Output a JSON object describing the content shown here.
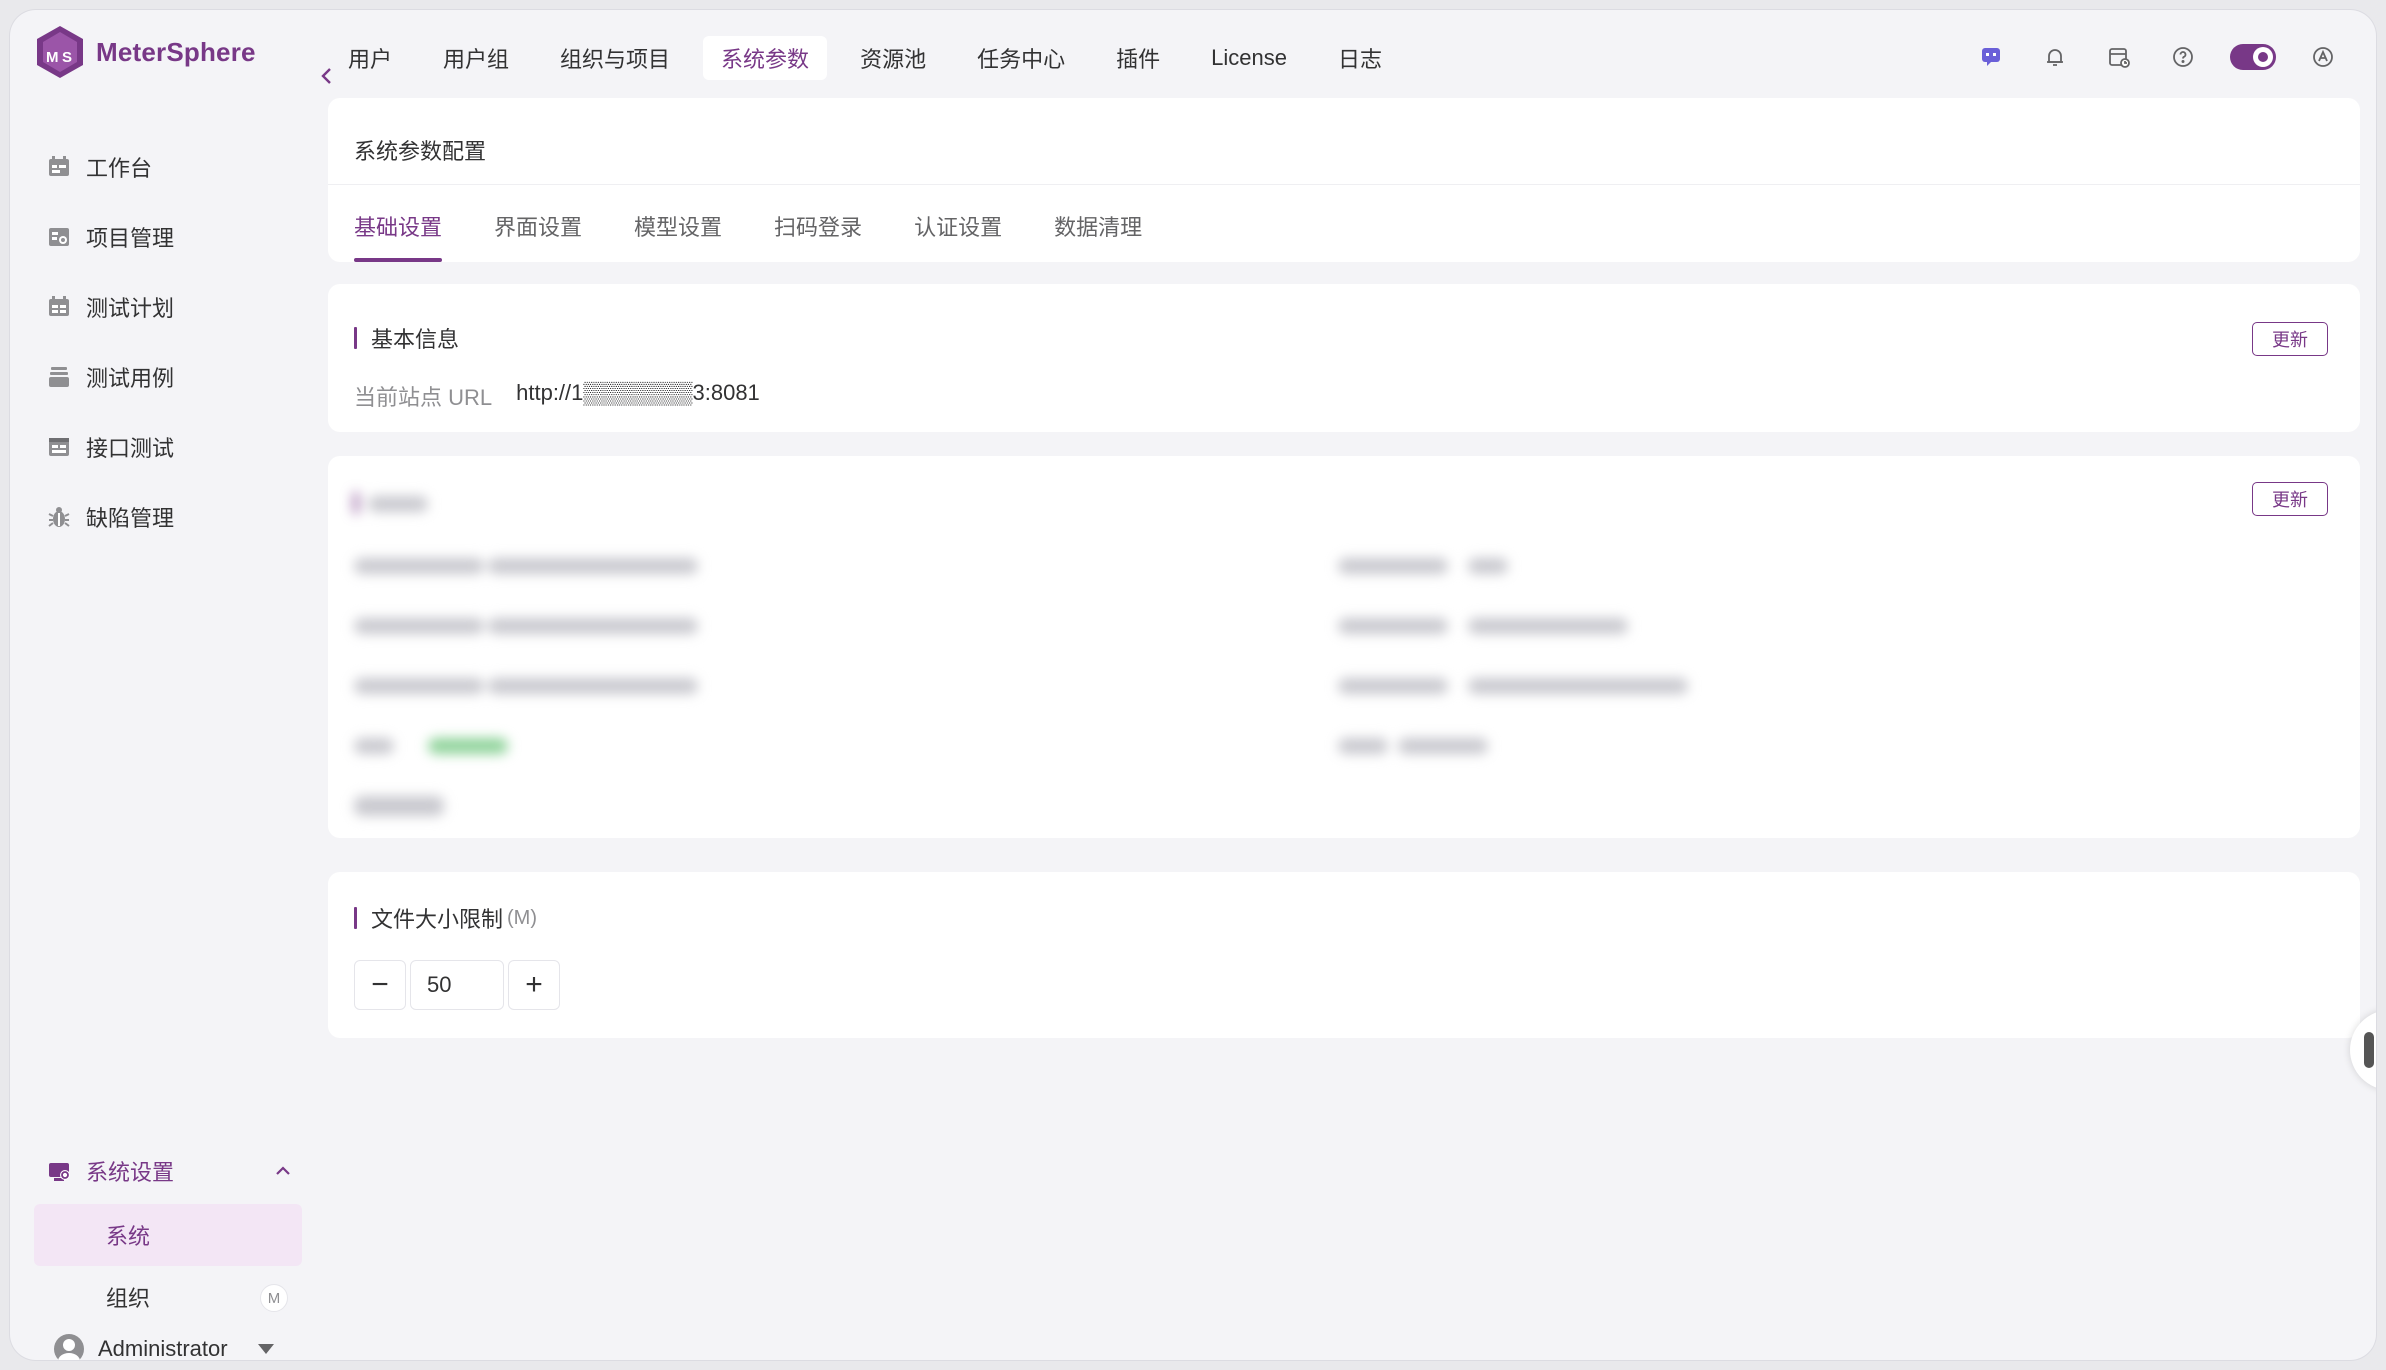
{
  "app": {
    "name": "MeterSphere"
  },
  "nav": {
    "items": [
      {
        "label": "用户"
      },
      {
        "label": "用户组"
      },
      {
        "label": "组织与项目"
      },
      {
        "label": "系统参数"
      },
      {
        "label": "资源池"
      },
      {
        "label": "任务中心"
      },
      {
        "label": "插件"
      },
      {
        "label": "License"
      },
      {
        "label": "日志"
      }
    ],
    "active_index": 3
  },
  "header_icons": [
    "chat-icon",
    "bell-icon",
    "task-icon",
    "help-icon",
    "theme-toggle",
    "language-icon"
  ],
  "sidebar": {
    "items": [
      {
        "label": "工作台",
        "icon": "workbench-icon"
      },
      {
        "label": "项目管理",
        "icon": "project-icon"
      },
      {
        "label": "测试计划",
        "icon": "test-plan-icon"
      },
      {
        "label": "测试用例",
        "icon": "test-case-icon"
      },
      {
        "label": "接口测试",
        "icon": "api-test-icon"
      },
      {
        "label": "缺陷管理",
        "icon": "bug-icon"
      }
    ],
    "settings": {
      "label": "系统设置",
      "children": [
        {
          "label": "系统",
          "active": true
        },
        {
          "label": "组织",
          "badge": "M"
        }
      ]
    },
    "user": {
      "name": "Administrator"
    }
  },
  "page": {
    "title": "系统参数配置",
    "tabs": [
      {
        "label": "基础设置"
      },
      {
        "label": "界面设置"
      },
      {
        "label": "模型设置"
      },
      {
        "label": "扫码登录"
      },
      {
        "label": "认证设置"
      },
      {
        "label": "数据清理"
      }
    ],
    "active_tab": 0
  },
  "basic_info": {
    "title": "基本信息",
    "update_label": "更新",
    "site_url_label": "当前站点 URL",
    "site_url_value": "http://1▒▒▒▒▒▒▒3:8081"
  },
  "mail": {
    "update_label": "更新"
  },
  "file_limit": {
    "title": "文件大小限制",
    "unit": "(M)",
    "value": "50",
    "minus": "−",
    "plus": "+"
  },
  "colors": {
    "brand": "#783887",
    "brand_light": "#f3e6f5",
    "text": "#323233",
    "muted": "#8f8f92"
  }
}
